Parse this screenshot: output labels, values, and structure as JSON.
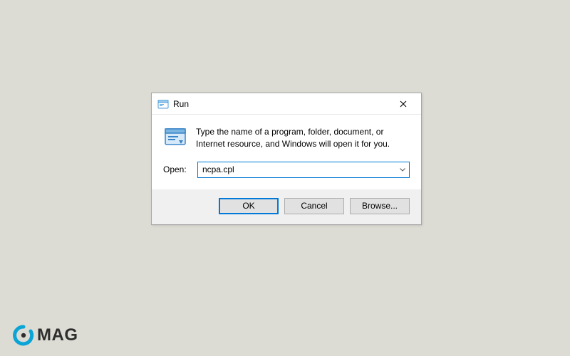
{
  "dialog": {
    "title": "Run",
    "description": "Type the name of a program, folder, document, or Internet resource, and Windows will open it for you.",
    "open_label": "Open:",
    "input_value": "ncpa.cpl",
    "buttons": {
      "ok": "OK",
      "cancel": "Cancel",
      "browse": "Browse..."
    }
  },
  "watermark": {
    "text": "MAG"
  }
}
